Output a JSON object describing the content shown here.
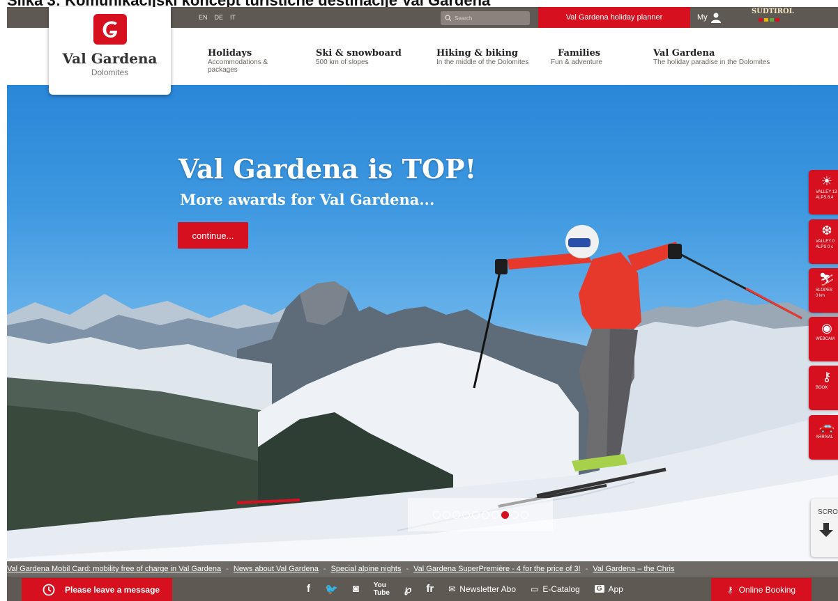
{
  "caption": "Slika 3: Komunikacijski koncept turistične destinacije Val Gardena",
  "colors": {
    "brand_red": "#d7101f",
    "topbar": "#5f5954",
    "ticker": "#6e6a66"
  },
  "topbar": {
    "languages": [
      "EN",
      "DE",
      "IT"
    ],
    "search_placeholder": "Search",
    "planner_label": "Val Gardena holiday planner",
    "my_label": "My",
    "suedtirol_label": "SÜDTIROL"
  },
  "logo": {
    "name": "Val Gardena",
    "sub": "Dolomites",
    "icon": "g-logo-icon"
  },
  "nav": [
    {
      "title": "Holidays",
      "sub": "Accommodations & packages"
    },
    {
      "title": "Ski & snowboard",
      "sub": "500 km of slopes"
    },
    {
      "title": "Hiking & biking",
      "sub": "In the middle of the Dolomites"
    },
    {
      "title": "Families",
      "sub": "Fun & adventure"
    },
    {
      "title": "Val Gardena",
      "sub": "The holiday paradise in the Dolomites"
    }
  ],
  "hero": {
    "headline": "Val Gardena is TOP!",
    "subhead": "More awards for Val Gardena...",
    "cta": "continue...",
    "slide_count": 10,
    "active_slide": 8
  },
  "side_tabs": [
    {
      "icon": "sun-icon",
      "line1": "VALLEY 13",
      "line2": "ALPS 8.4"
    },
    {
      "icon": "snowflake-icon",
      "line1": "VALLEY 0",
      "line2": "ALPS 0 c"
    },
    {
      "icon": "skier-icon",
      "line1": "SLOPES",
      "line2": "0 km"
    },
    {
      "icon": "webcam-icon",
      "line1": "WEBCAM",
      "line2": ""
    },
    {
      "icon": "key-icon",
      "line1": "BOOK",
      "line2": ""
    },
    {
      "icon": "car-icon",
      "line1": "ARRIVAL",
      "line2": ""
    }
  ],
  "scroll_label": "SCROLL",
  "ticker": [
    "Val Gardena Mobil Card: mobility free of charge in Val Gardena",
    "News about Val Gardena",
    "Special alpine nights",
    "Val Gardena SuperPremière - 4 for the price of 3!",
    "Val Gardena – the Chris"
  ],
  "bottom": {
    "message": "Please leave a message",
    "social": [
      "f",
      "twitter",
      "instagram",
      "youtube",
      "pinterest",
      "flickr"
    ],
    "newsletter": "Newsletter Abo",
    "catalog": "E-Catalog",
    "app": "App",
    "booking": "Online Booking"
  }
}
